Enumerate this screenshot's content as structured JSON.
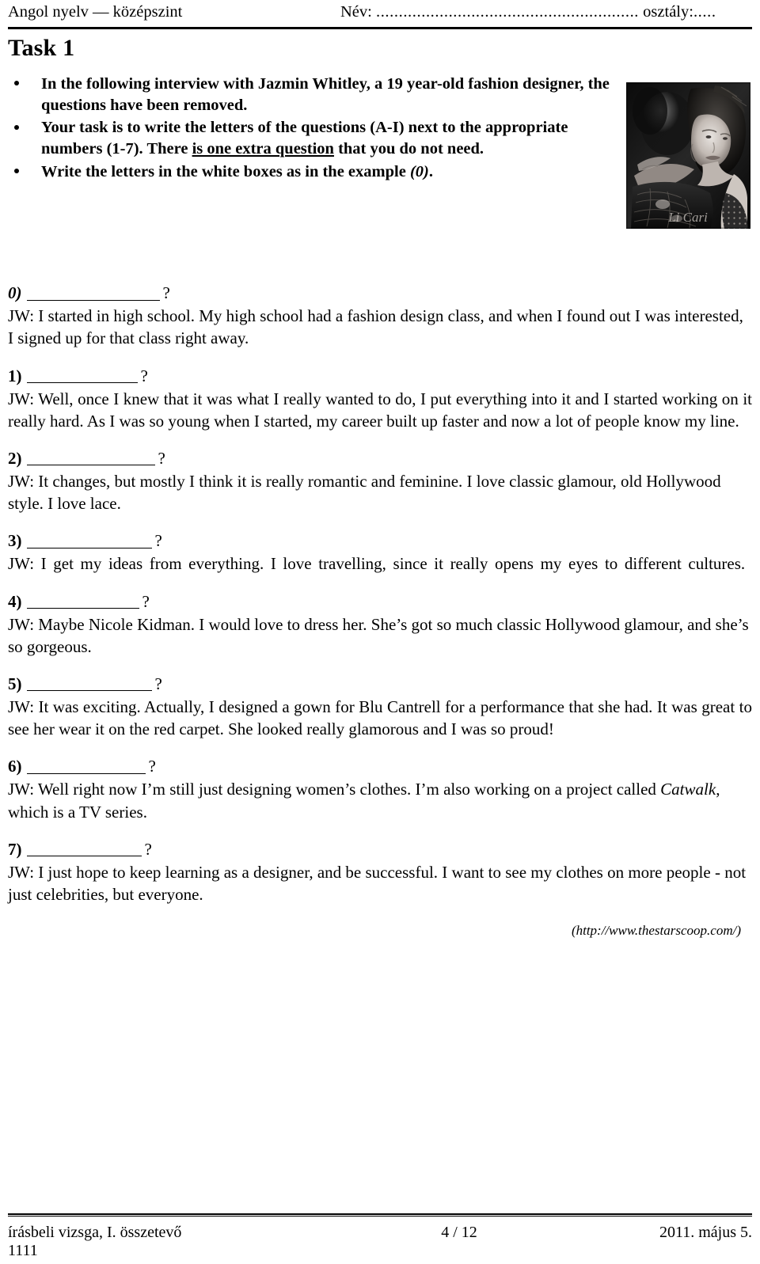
{
  "header": {
    "subject": "Angol nyelv — középszint",
    "name_label": "Név:",
    "name_dots": "..........................................................",
    "class_label": "osztály:",
    "class_dots": "....."
  },
  "task": {
    "title": "Task 1",
    "instructions": [
      "In the following interview with Jazmin Whitley, a 19 year-old fashion designer, the questions have been removed.",
      "Your task is to write the letters of the questions (A-I) next to the appropriate numbers (1-7). There is one extra question that you do not need.",
      "Write the letters in the white boxes as in the example (0)."
    ],
    "instruction_underlined_phrase": "is one extra question",
    "instruction_italic_example": "(0)"
  },
  "photo": {
    "alt": "black-and-white portrait of a woman in a lace gown",
    "watermark": "Li Cari"
  },
  "items": [
    {
      "number": "0)",
      "question_mark": "?",
      "blank_width": 168,
      "speaker": "JW:",
      "answer": "JW: I started in high school. My high school had a fashion design class, and when I found out I was interested, I signed up for that class right away."
    },
    {
      "number": "1)",
      "question_mark": "?",
      "blank_width": 140,
      "speaker": "JW:",
      "answer": "JW: Well, once I knew that it was what I really wanted to do, I put everything into it and I started working on it really hard. As I was so young when I started, my career built up faster and now a lot of people know my line."
    },
    {
      "number": "2)",
      "question_mark": "?",
      "blank_width": 162,
      "speaker": "JW:",
      "answer": "JW: It changes, but mostly I think it is really romantic and feminine. I love classic glamour, old Hollywood style. I love lace."
    },
    {
      "number": "3)",
      "question_mark": "?",
      "blank_width": 158,
      "speaker": "JW:",
      "answer": "JW: I get my ideas from everything. I love travelling, since it really opens my eyes to different cultures."
    },
    {
      "number": "4)",
      "question_mark": "?",
      "blank_width": 142,
      "speaker": "JW:",
      "answer": "JW: Maybe Nicole Kidman. I would love to dress her. She’s got so much classic Hollywood glamour, and she’s so gorgeous."
    },
    {
      "number": "5)",
      "question_mark": "?",
      "blank_width": 158,
      "speaker": "JW:",
      "answer": "JW: It was exciting. Actually, I designed a gown for Blu Cantrell for a performance that she had. It was great to see her wear it on the red carpet. She looked really glamorous and I was so proud!"
    },
    {
      "number": "6)",
      "question_mark": "?",
      "blank_width": 150,
      "speaker": "JW:",
      "answer_part1": "JW:  Well right now I’m still just designing women’s clothes. I’m also working on a project called ",
      "answer_italic": "Catwalk",
      "answer_part2": ", which is a TV series."
    },
    {
      "number": "7)",
      "question_mark": "?",
      "blank_width": 145,
      "speaker": "JW:",
      "answer": "JW: I just hope to keep learning as a designer, and be successful. I want to see my clothes on more people - not just celebrities, but everyone."
    }
  ],
  "source": "(http://www.thestarscoop.com/)",
  "footer": {
    "left": "írásbeli vizsga, I. összetevő",
    "center": "4 / 12",
    "right": "2011. május 5.",
    "code": "1111"
  }
}
